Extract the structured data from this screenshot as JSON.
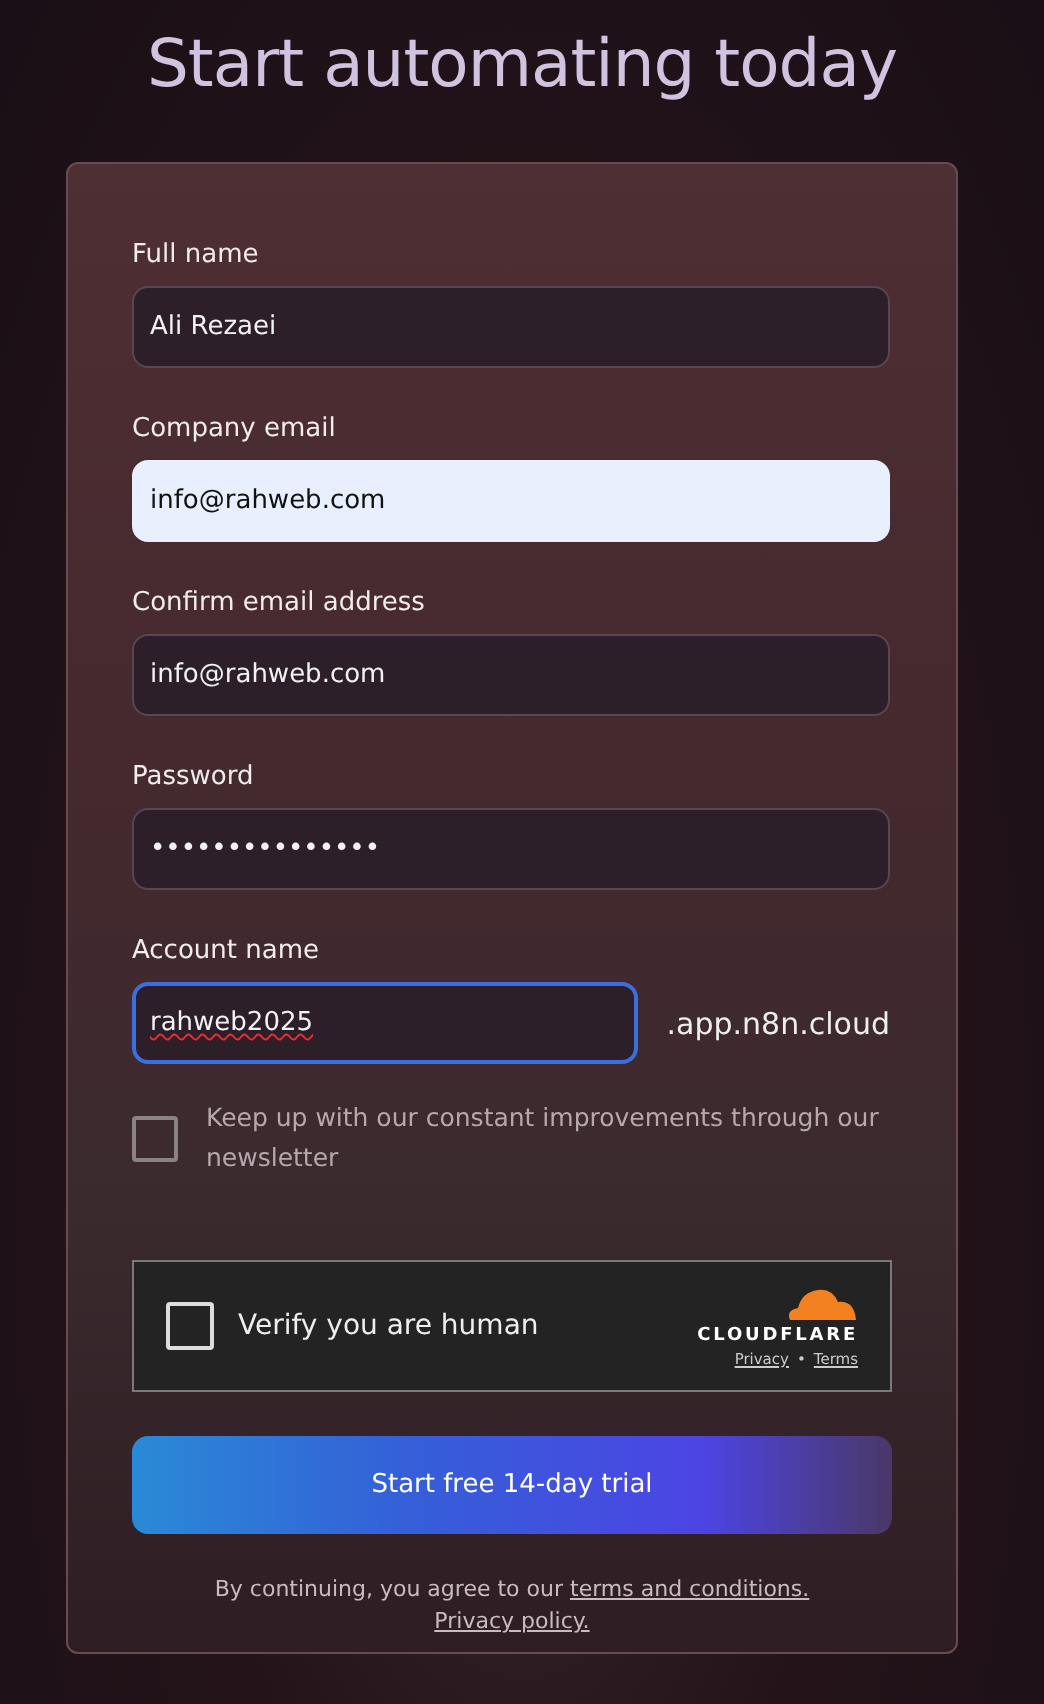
{
  "title": "Start automating today",
  "fields": [
    {
      "label": "Full name",
      "value": "Ali Rezaei",
      "autofilled": false,
      "focused": false,
      "misspelled": false
    },
    {
      "label": "Company email",
      "value": "info@rahweb.com",
      "autofilled": true,
      "focused": false,
      "misspelled": false
    },
    {
      "label": "Confirm email address",
      "value": "info@rahweb.com",
      "autofilled": false,
      "focused": false,
      "misspelled": false
    },
    {
      "label": "Password",
      "value": "•••••••••••••••",
      "autofilled": false,
      "focused": false,
      "misspelled": false
    },
    {
      "label": "Account name",
      "value": "rahweb2025",
      "autofilled": false,
      "focused": true,
      "misspelled": true,
      "suffix": ".app.n8n.cloud"
    }
  ],
  "newsletter": {
    "label": "Keep up with our constant improvements through our newsletter",
    "checked": false
  },
  "captcha": {
    "label": "Verify you are human",
    "checked": false,
    "brand": "CLOUDFLARE",
    "links": [
      "Privacy",
      "Terms"
    ],
    "separator": "•"
  },
  "submit": "Start free 14-day trial",
  "legal": {
    "text": "By continuing, you agree to our",
    "links": [
      "terms and conditions.",
      "Privacy policy."
    ]
  }
}
